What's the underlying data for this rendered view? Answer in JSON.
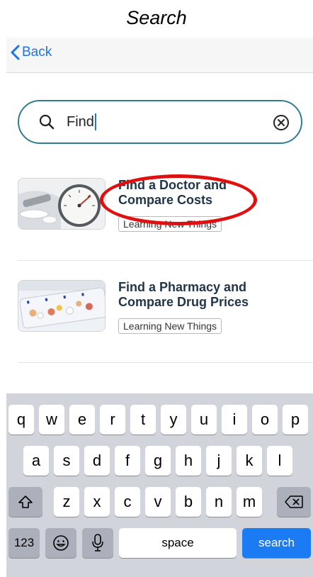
{
  "caption": "Search",
  "nav": {
    "back_label": "Back"
  },
  "search": {
    "value": "Find"
  },
  "results": [
    {
      "title_line1": "Find a Doctor and",
      "title_line2": "Compare Costs",
      "tag": "Learning New Things"
    },
    {
      "title_line1": "Find a Pharmacy and",
      "title_line2": "Compare Drug Prices",
      "tag": "Learning New Things"
    }
  ],
  "keyboard": {
    "row1": [
      "q",
      "w",
      "e",
      "r",
      "t",
      "y",
      "u",
      "i",
      "o",
      "p"
    ],
    "row2": [
      "a",
      "s",
      "d",
      "f",
      "g",
      "h",
      "j",
      "k",
      "l"
    ],
    "row3": [
      "z",
      "x",
      "c",
      "v",
      "b",
      "n",
      "m"
    ],
    "numbers_label": "123",
    "space_label": "space",
    "search_label": "search"
  },
  "colors": {
    "accent": "#1a74e8",
    "search_border": "#2d7e91",
    "highlight": "#e01010",
    "keyboard_bg": "#d1d4da"
  }
}
